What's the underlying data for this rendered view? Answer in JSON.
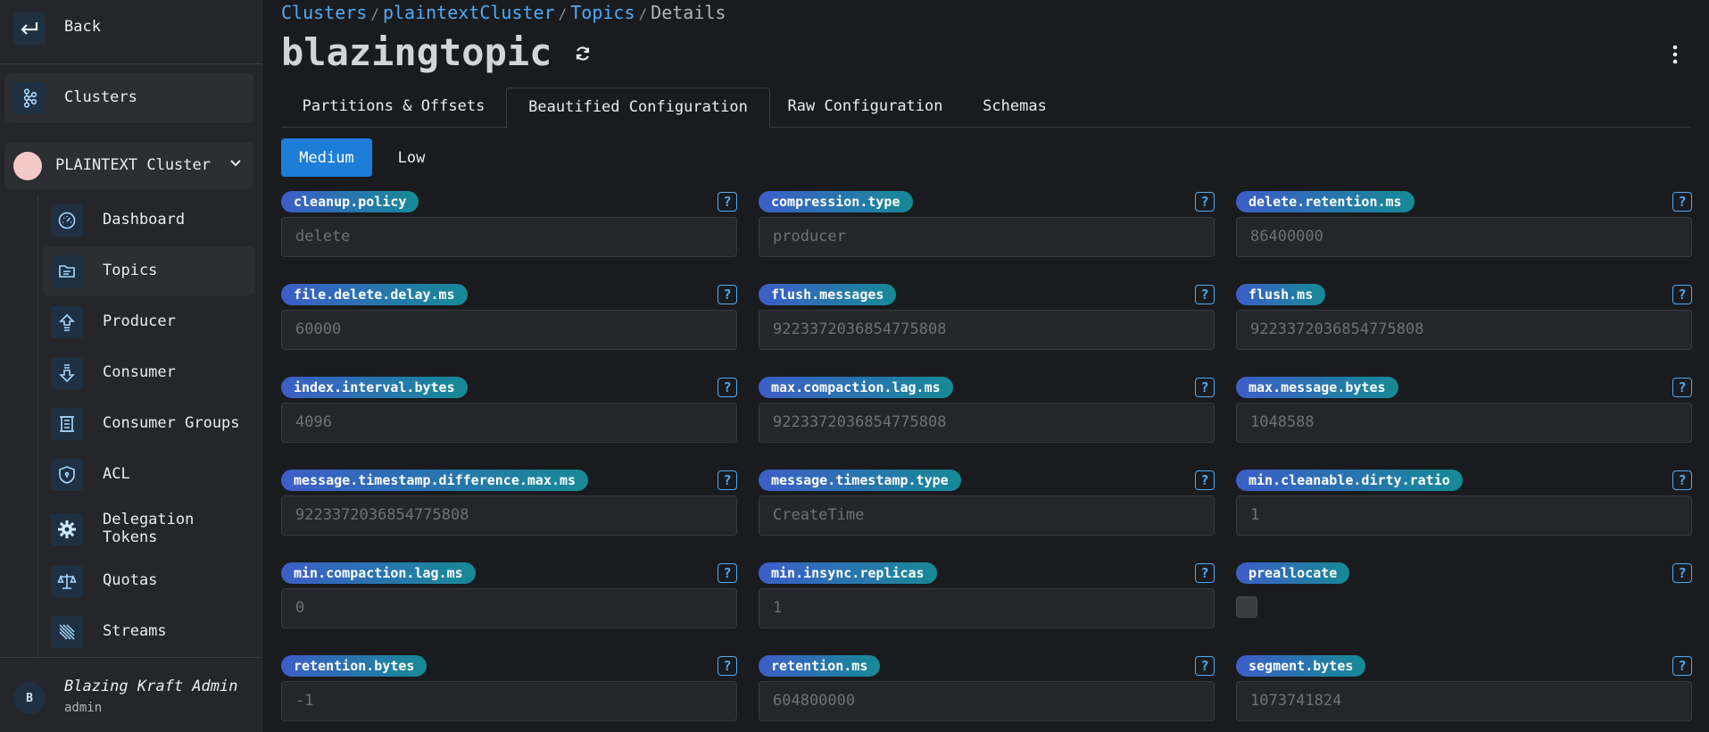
{
  "sidebar": {
    "back_label": "Back",
    "clusters_label": "Clusters",
    "cluster_name": "PLAINTEXT Cluster",
    "items": [
      {
        "label": "Dashboard",
        "icon": "gauge-icon"
      },
      {
        "label": "Topics",
        "icon": "folder-icon",
        "active": true
      },
      {
        "label": "Producer",
        "icon": "upload-icon"
      },
      {
        "label": "Consumer",
        "icon": "download-icon"
      },
      {
        "label": "Consumer Groups",
        "icon": "stack-icon"
      },
      {
        "label": "ACL",
        "icon": "shield-icon"
      },
      {
        "label": "Delegation Tokens",
        "icon": "gear-icon"
      },
      {
        "label": "Quotas",
        "icon": "scale-icon"
      },
      {
        "label": "Streams",
        "icon": "streams-icon"
      }
    ],
    "user": {
      "avatar": "B",
      "name": "Blazing Kraft Admin",
      "role": "admin"
    }
  },
  "breadcrumb": {
    "items": [
      "Clusters",
      "plaintextCluster",
      "Topics"
    ],
    "current": "Details"
  },
  "page_title": "blazingtopic",
  "tabs": [
    "Partitions & Offsets",
    "Beautified Configuration",
    "Raw Configuration",
    "Schemas"
  ],
  "active_tab": "Beautified Configuration",
  "importance": {
    "options": [
      "Medium",
      "Low"
    ],
    "selected": "Medium"
  },
  "config": [
    {
      "name": "cleanup.policy",
      "value": "delete"
    },
    {
      "name": "compression.type",
      "value": "producer"
    },
    {
      "name": "delete.retention.ms",
      "value": "86400000"
    },
    {
      "name": "file.delete.delay.ms",
      "value": "60000"
    },
    {
      "name": "flush.messages",
      "value": "9223372036854775808"
    },
    {
      "name": "flush.ms",
      "value": "9223372036854775808"
    },
    {
      "name": "index.interval.bytes",
      "value": "4096"
    },
    {
      "name": "max.compaction.lag.ms",
      "value": "9223372036854775808"
    },
    {
      "name": "max.message.bytes",
      "value": "1048588"
    },
    {
      "name": "message.timestamp.difference.max.ms",
      "value": "9223372036854775808"
    },
    {
      "name": "message.timestamp.type",
      "value": "CreateTime"
    },
    {
      "name": "min.cleanable.dirty.ratio",
      "value": "1"
    },
    {
      "name": "min.compaction.lag.ms",
      "value": "0"
    },
    {
      "name": "min.insync.replicas",
      "value": "1"
    },
    {
      "name": "preallocate",
      "value": false
    },
    {
      "name": "retention.bytes",
      "value": "-1"
    },
    {
      "name": "retention.ms",
      "value": "604800000"
    },
    {
      "name": "segment.bytes",
      "value": "1073741824"
    }
  ],
  "help_glyph": "?",
  "colors": {
    "accent": "#1c7ed6",
    "link": "#4dabf7",
    "badge_from": "#3c5ec8",
    "badge_to": "#168a96"
  }
}
